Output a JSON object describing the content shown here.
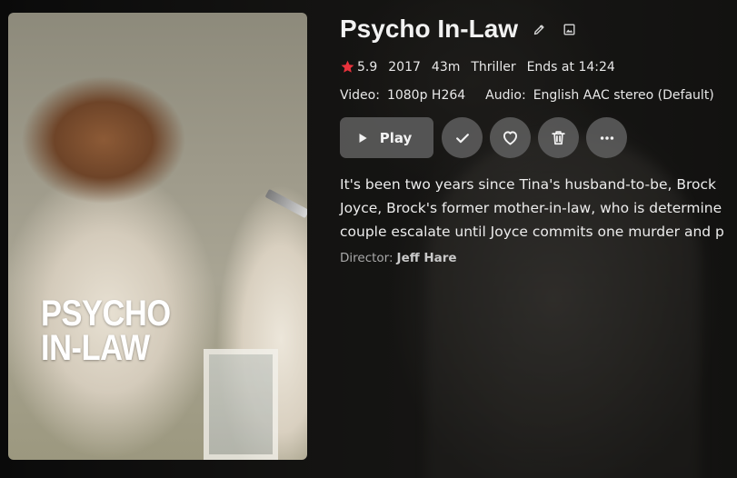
{
  "item": {
    "title": "Psycho In-Law",
    "rating": "5.9",
    "year": "2017",
    "runtime": "43m",
    "genre": "Thriller",
    "ends_at": "Ends at 14:24"
  },
  "poster": {
    "title_line1": "PSYCHO",
    "title_line2": "IN-LAW"
  },
  "media": {
    "video_label": "Video:",
    "video_value": "1080p H264",
    "audio_label": "Audio:",
    "audio_value": "English AAC stereo (Default)"
  },
  "actions": {
    "play_label": "Play"
  },
  "overview": {
    "line1": "It's been two years since Tina's husband-to-be, Brock",
    "line2": "Joyce, Brock's former mother-in-law, who is determine",
    "line3": "couple escalate until Joyce commits one murder and p"
  },
  "director": {
    "label": "Director:",
    "name": "Jeff Hare"
  },
  "icons": {
    "edit": "pencil-icon",
    "image": "image-icon",
    "rating": "star-icon",
    "play": "play-icon",
    "played": "check-icon",
    "favorite": "heart-icon",
    "delete": "trash-icon",
    "more": "more-icon"
  },
  "colors": {
    "star": "#e8323c",
    "button_bg": "#5f5f5f",
    "text": "#eeeeee",
    "muted": "#a9a9a9"
  }
}
